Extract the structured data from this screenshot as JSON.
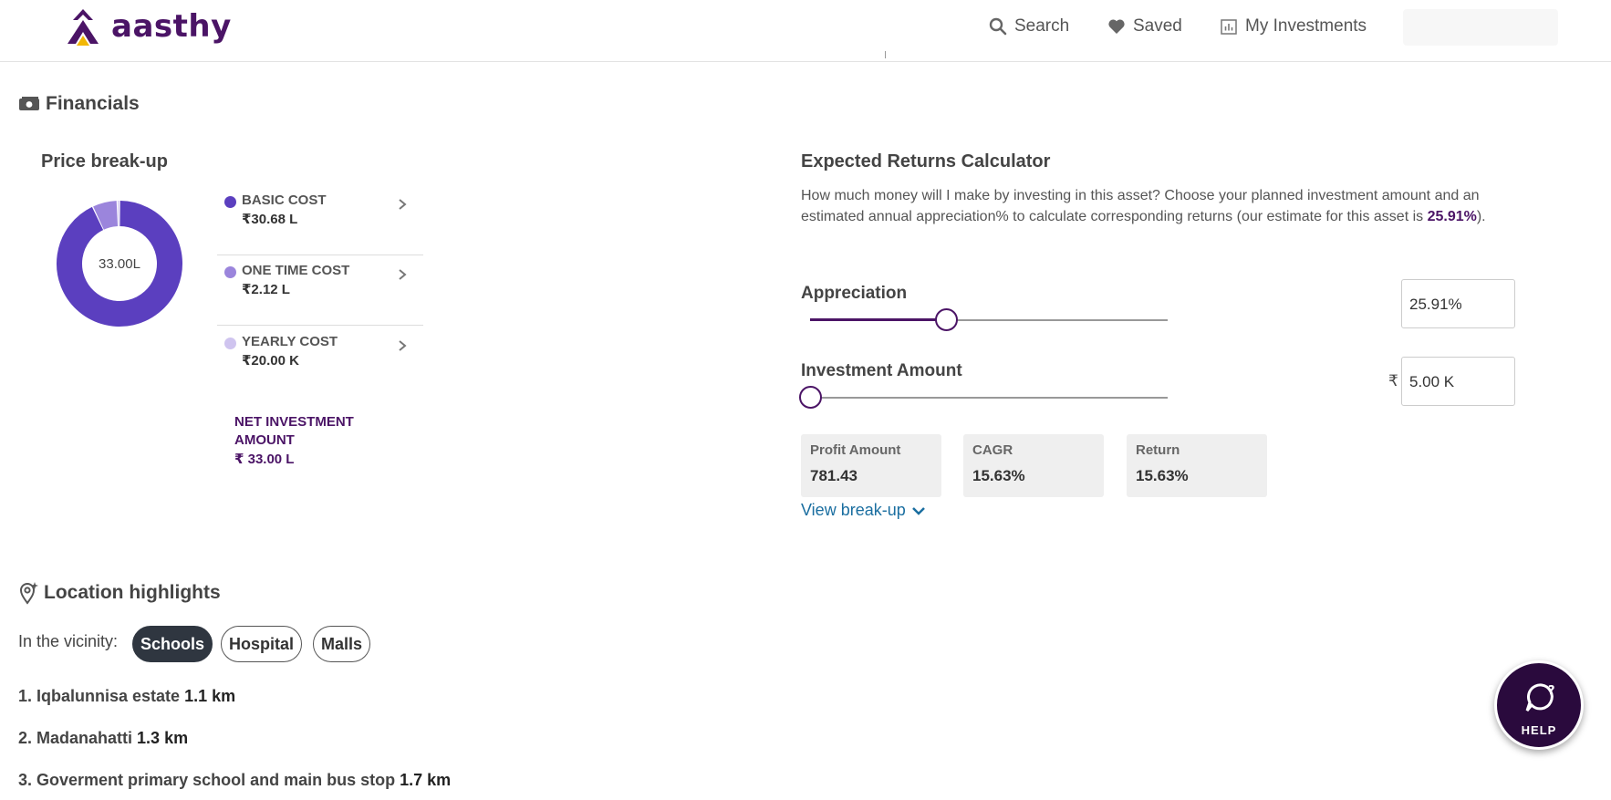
{
  "header": {
    "brand": "aasthy",
    "nav": [
      {
        "label": "Search",
        "icon": "search-icon"
      },
      {
        "label": "Saved",
        "icon": "heart-icon"
      },
      {
        "label": "My Investments",
        "icon": "bar-chart-icon"
      }
    ]
  },
  "financials": {
    "title": "Financials",
    "price_breakup": {
      "title": "Price break-up",
      "center_label": "33.00L",
      "items": [
        {
          "name": "BASIC COST",
          "value": "₹30.68 L",
          "color": "#5b3fbf"
        },
        {
          "name": "ONE TIME COST",
          "value": "₹2.12 L",
          "color": "#9b85dc"
        },
        {
          "name": "YEARLY COST",
          "value": "₹20.00 K",
          "color": "#cfc4ef"
        }
      ],
      "net_label": "NET INVESTMENT AMOUNT",
      "net_value": "₹ 33.00 L"
    }
  },
  "chart_data": {
    "type": "pie",
    "categories": [
      "BASIC COST",
      "ONE TIME COST",
      "YEARLY COST"
    ],
    "values": [
      30.68,
      2.12,
      0.2
    ],
    "colors": [
      "#5b3fbf",
      "#9b85dc",
      "#cfc4ef"
    ]
  },
  "calculator": {
    "title": "Expected Returns Calculator",
    "desc_prefix": "How much money will I make by investing in this asset? Choose your planned investment amount and an estimated annual appreciation% to calculate corresponding returns (our estimate for this asset is ",
    "desc_estimate": "25.91%",
    "desc_suffix": ").",
    "appreciation": {
      "label": "Appreciation",
      "value": "25.91%",
      "fraction": 0.38
    },
    "investment": {
      "label": "Investment Amount",
      "currency": "₹",
      "value": "5.00 K",
      "fraction": 0.0
    },
    "stats": [
      {
        "label": "Profit Amount",
        "value": "781.43"
      },
      {
        "label": "CAGR",
        "value": "15.63%"
      },
      {
        "label": "Return",
        "value": "15.63%"
      }
    ],
    "view_link": "View break-up"
  },
  "location": {
    "title": "Location highlights",
    "vicinity_label": "In the vicinity:",
    "chips": [
      {
        "label": "Schools",
        "active": true
      },
      {
        "label": "Hospital",
        "active": false
      },
      {
        "label": "Malls",
        "active": false
      }
    ],
    "items": [
      {
        "name": "1. Iqbalunnisa estate",
        "distance": "1.1 km"
      },
      {
        "name": "2. Madanahatti",
        "distance": "1.3 km"
      },
      {
        "name": "3. Goverment primary school and main bus stop",
        "distance": "1.7 km"
      }
    ]
  },
  "help": {
    "label": "HELP"
  }
}
